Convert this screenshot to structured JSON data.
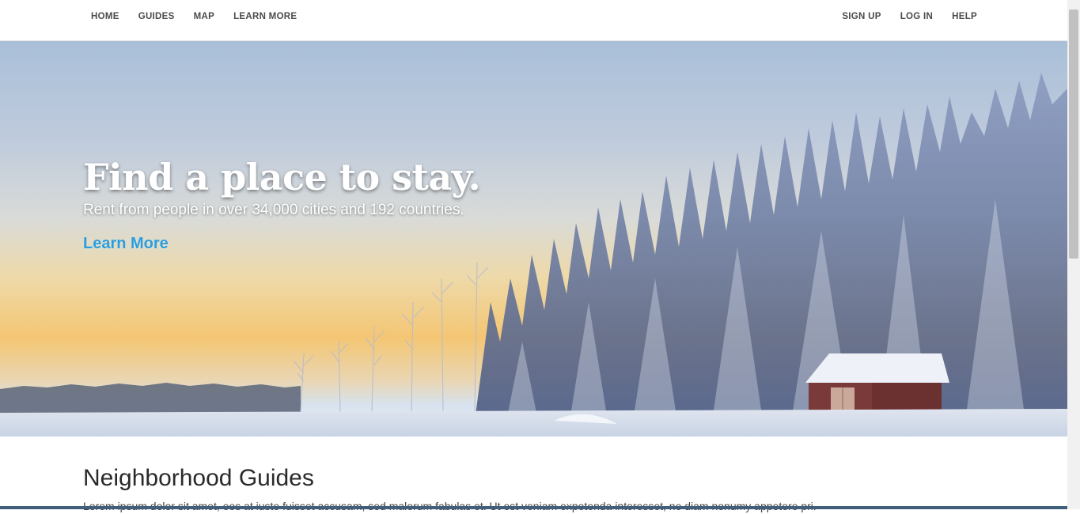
{
  "nav": {
    "left": [
      {
        "label": "HOME"
      },
      {
        "label": "GUIDES"
      },
      {
        "label": "MAP"
      },
      {
        "label": "LEARN MORE"
      }
    ],
    "right": [
      {
        "label": "SIGN UP"
      },
      {
        "label": "LOG IN"
      },
      {
        "label": "HELP"
      }
    ]
  },
  "hero": {
    "title": "Find a place to stay.",
    "subtitle": "Rent from people in over 34,000 cities and 192 countries.",
    "link": "Learn More",
    "link_color": "#2b9ee0"
  },
  "section": {
    "title": "Neighborhood Guides",
    "body": "Lorem ipsum dolor sit amet, eos at iusto fuisset accusam, sed malorum fabulas et. Ut est veniam expetenda interesset, ne diam nonumy appetere pri."
  }
}
